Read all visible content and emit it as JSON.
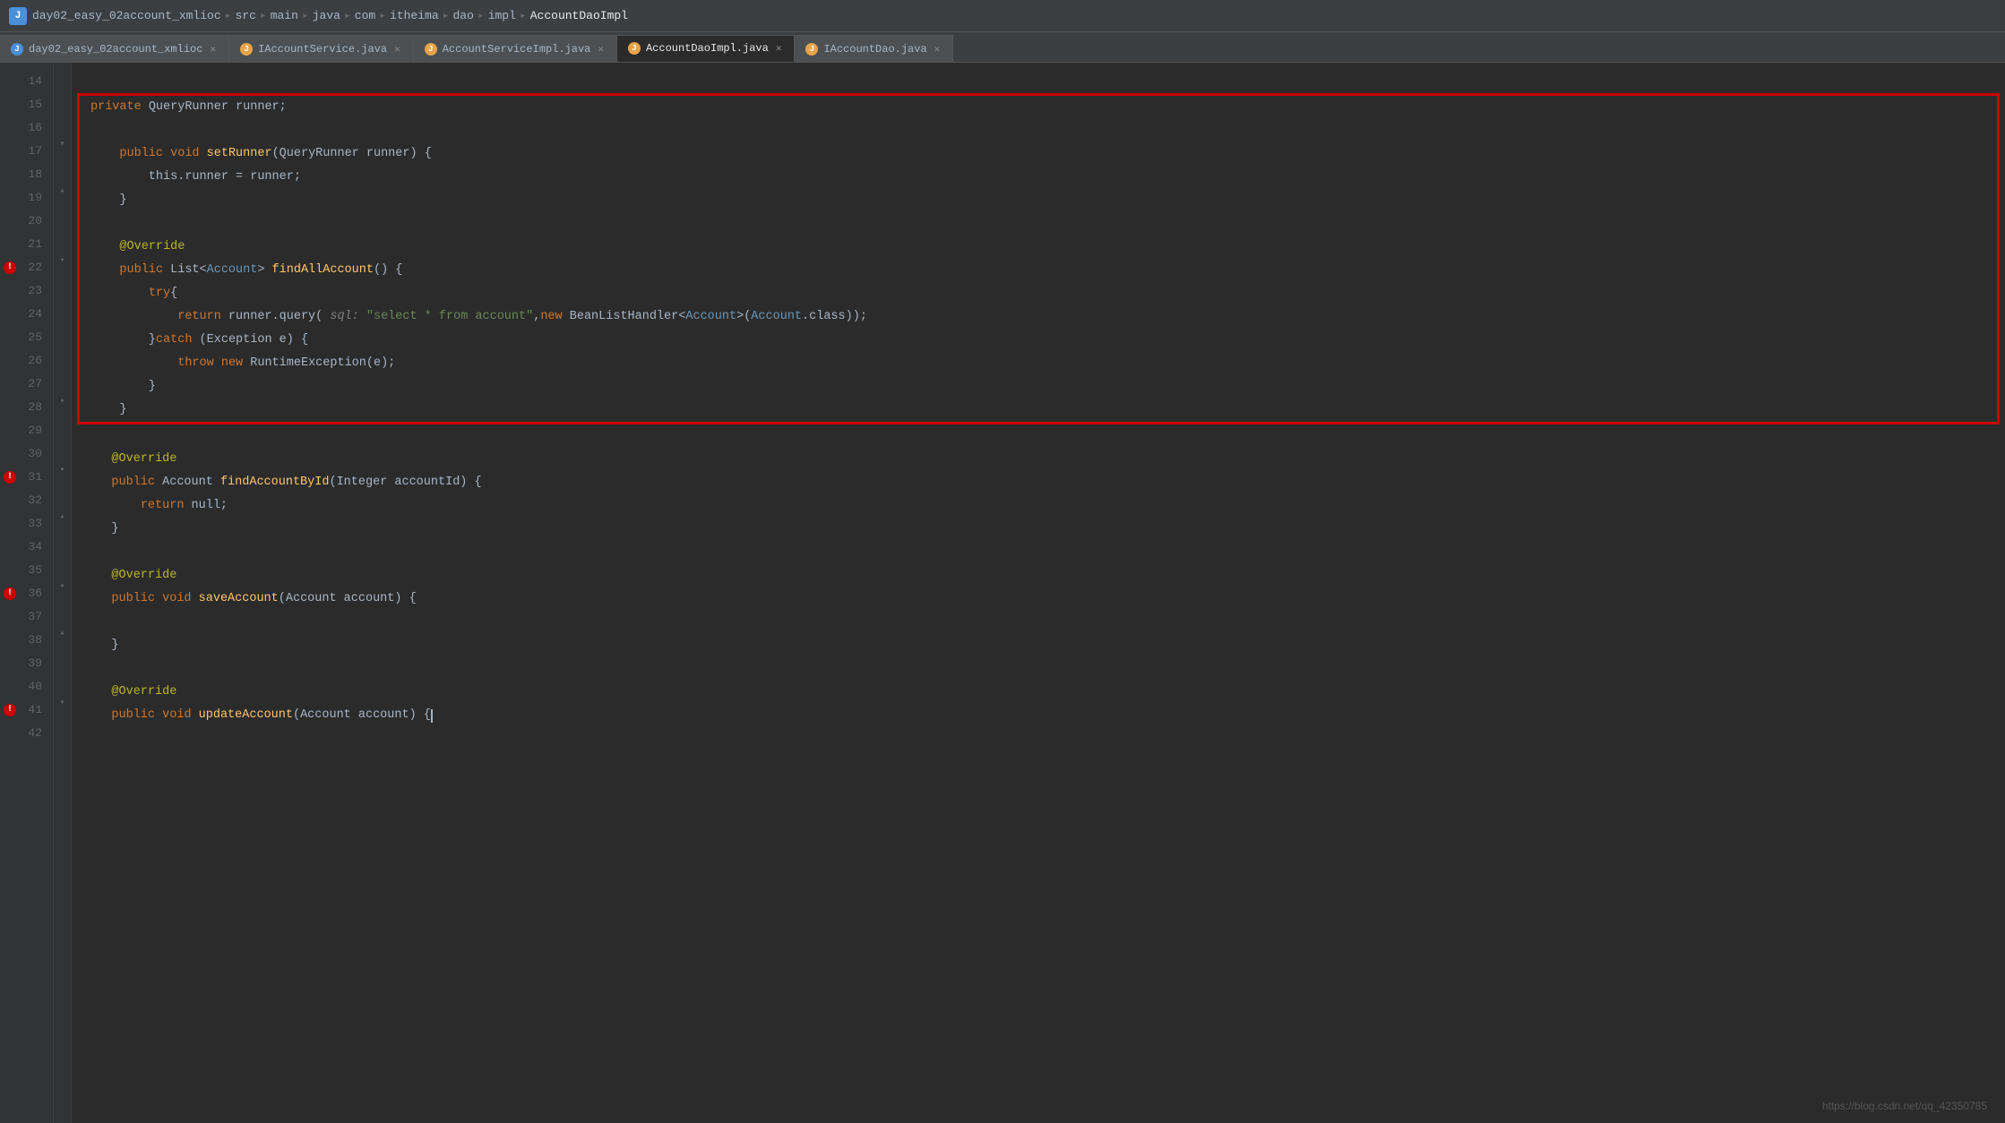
{
  "titlebar": {
    "icon": "J",
    "breadcrumb": [
      "day02_easy_02account_xmlioc",
      "src",
      "main",
      "java",
      "com",
      "itheima",
      "dao",
      "impl",
      "AccountDaoImpl"
    ]
  },
  "tabs": [
    {
      "id": "tab1",
      "label": "day02_easy_02account_xmlioc",
      "icon_color": "blue",
      "active": false,
      "closable": true
    },
    {
      "id": "tab2",
      "label": "IAccountService.java",
      "icon_color": "orange",
      "active": false,
      "closable": true
    },
    {
      "id": "tab3",
      "label": "AccountServiceImpl.java",
      "icon_color": "orange",
      "active": false,
      "closable": true
    },
    {
      "id": "tab4",
      "label": "AccountDaoImpl.java",
      "icon_color": "orange",
      "active": true,
      "closable": true
    },
    {
      "id": "tab5",
      "label": "IAccountDao.java",
      "icon_color": "orange",
      "active": false,
      "closable": true
    }
  ],
  "lines": [
    {
      "num": 14,
      "code": "",
      "badge": null
    },
    {
      "num": 15,
      "code": "    private QueryRunner runner;",
      "badge": null,
      "in_box": true
    },
    {
      "num": 16,
      "code": "",
      "badge": null,
      "in_box": true
    },
    {
      "num": 17,
      "code": "    public void setRunner(QueryRunner runner) {",
      "badge": null,
      "in_box": true,
      "fold": true
    },
    {
      "num": 18,
      "code": "        this.runner = runner;",
      "badge": null,
      "in_box": true
    },
    {
      "num": 19,
      "code": "    }",
      "badge": null,
      "in_box": true,
      "fold": true
    },
    {
      "num": 20,
      "code": "",
      "badge": null,
      "in_box": true
    },
    {
      "num": 21,
      "code": "    @Override",
      "badge": null,
      "in_box": true
    },
    {
      "num": 22,
      "code": "    public List<Account> findAllAccount() {",
      "badge": "red",
      "in_box": true,
      "fold": true
    },
    {
      "num": 23,
      "code": "        try{",
      "badge": null,
      "in_box": true
    },
    {
      "num": 24,
      "code": "            return runner.query( sql: \"select * from account\",new BeanListHandler<Account>(Account.class));",
      "badge": null,
      "in_box": true
    },
    {
      "num": 25,
      "code": "        }catch (Exception e) {",
      "badge": null,
      "in_box": true
    },
    {
      "num": 26,
      "code": "            throw new RuntimeException(e);",
      "badge": null,
      "in_box": true
    },
    {
      "num": 27,
      "code": "        }",
      "badge": null,
      "in_box": true
    },
    {
      "num": 28,
      "code": "    }",
      "badge": null,
      "in_box": true,
      "fold": true
    },
    {
      "num": 29,
      "code": "",
      "badge": null
    },
    {
      "num": 30,
      "code": "    @Override",
      "badge": null
    },
    {
      "num": 31,
      "code": "    public Account findAccountById(Integer accountId) {",
      "badge": "red",
      "fold": true
    },
    {
      "num": 32,
      "code": "        return null;",
      "badge": null
    },
    {
      "num": 33,
      "code": "    }",
      "badge": null,
      "fold": true
    },
    {
      "num": 34,
      "code": "",
      "badge": null
    },
    {
      "num": 35,
      "code": "    @Override",
      "badge": null
    },
    {
      "num": 36,
      "code": "    public void saveAccount(Account account) {",
      "badge": "red",
      "fold": true
    },
    {
      "num": 37,
      "code": "",
      "badge": null
    },
    {
      "num": 38,
      "code": "    }",
      "badge": null,
      "fold": true
    },
    {
      "num": 39,
      "code": "",
      "badge": null
    },
    {
      "num": 40,
      "code": "    @Override",
      "badge": null
    },
    {
      "num": 41,
      "code": "    public void updateAccount(Account account) {",
      "badge": "red",
      "fold": true
    },
    {
      "num": 42,
      "code": "",
      "badge": null
    }
  ],
  "watermark": "https://blog.csdn.net/qq_42350785"
}
